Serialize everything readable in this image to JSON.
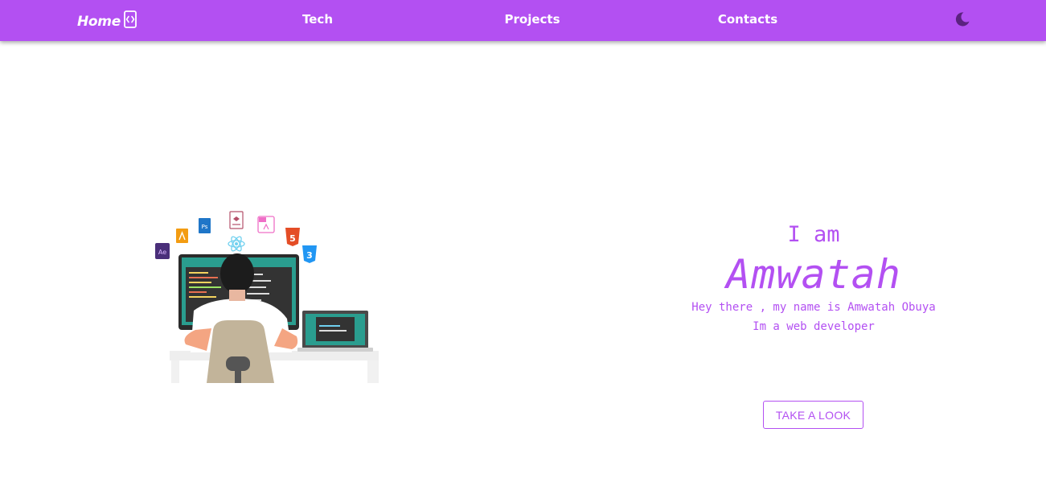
{
  "navbar": {
    "home_label": "Home",
    "home_icon": "code-brackets-icon",
    "links": [
      {
        "label": "Tech"
      },
      {
        "label": "Projects"
      },
      {
        "label": "Contacts"
      }
    ],
    "theme_icon": "moon-icon",
    "background_color": "#b350f2"
  },
  "hero": {
    "illustration": "developer-at-computer-illustration",
    "intro": "I am",
    "name": "Amwatah",
    "description_line1": "Hey there , my name is Amwatah Obuya",
    "description_line2": "Im a web developer",
    "cta_label": "TAKE A LOOK",
    "accent_color": "#b350f2"
  }
}
